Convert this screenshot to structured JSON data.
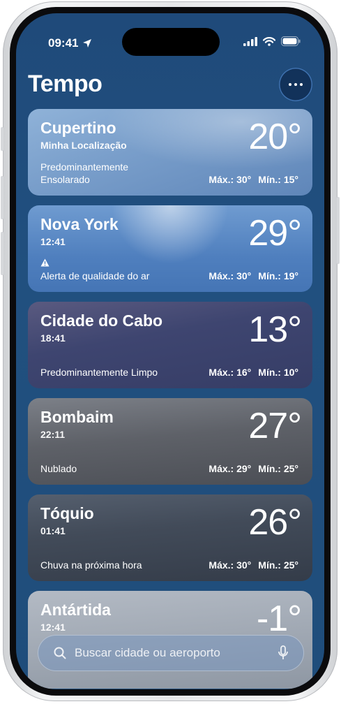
{
  "status": {
    "time": "09:41"
  },
  "app": {
    "title": "Tempo"
  },
  "cities": [
    {
      "name": "Cupertino",
      "sub": "Minha Localização",
      "temp": "20°",
      "condition": "Predominantemente Ensolarado",
      "high": "Máx.: 30°",
      "low": "Mín.: 15°"
    },
    {
      "name": "Nova York",
      "sub": "12:41",
      "temp": "29°",
      "condition": "Alerta de qualidade do ar",
      "high": "Máx.: 30°",
      "low": "Mín.: 19°"
    },
    {
      "name": "Cidade do Cabo",
      "sub": "18:41",
      "temp": "13°",
      "condition": "Predominantemente Limpo",
      "high": "Máx.: 16°",
      "low": "Mín.: 10°"
    },
    {
      "name": "Bombaim",
      "sub": "22:11",
      "temp": "27°",
      "condition": "Nublado",
      "high": "Máx.: 29°",
      "low": "Mín.: 25°"
    },
    {
      "name": "Tóquio",
      "sub": "01:41",
      "temp": "26°",
      "condition": "Chuva na próxima hora",
      "high": "Máx.: 30°",
      "low": "Mín.: 25°"
    },
    {
      "name": "Antártida",
      "sub": "12:41",
      "temp": "-1°"
    }
  ],
  "search": {
    "placeholder": "Buscar cidade ou aeroporto"
  },
  "icons": {
    "location": "location-arrow-icon",
    "signal": "cellular-signal-icon",
    "wifi": "wifi-icon",
    "battery": "battery-icon",
    "more": "ellipsis-icon",
    "warning": "warning-icon",
    "search": "search-icon",
    "mic": "microphone-icon"
  }
}
